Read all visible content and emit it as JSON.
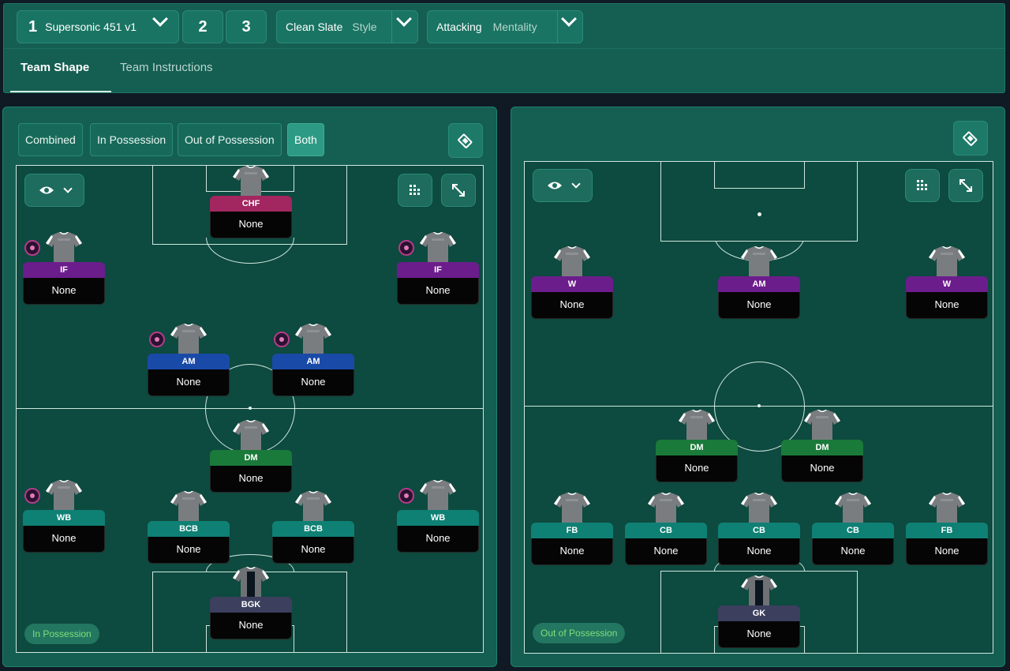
{
  "header": {
    "tactic": {
      "slot": "1",
      "name": "Supersonic 451 v1"
    },
    "slots": [
      "2",
      "3"
    ],
    "style": {
      "value": "Clean Slate",
      "label": "Style"
    },
    "mentality": {
      "value": "Attacking",
      "label": "Mentality"
    },
    "tabs": [
      {
        "label": "Team Shape",
        "active": true
      },
      {
        "label": "Team Instructions",
        "active": false
      }
    ]
  },
  "left_panel": {
    "view_toggle": [
      "Combined",
      "In Possession",
      "Out of Possession",
      "Both"
    ],
    "active_toggle": "Both",
    "phase_label": "In Possession",
    "players": [
      {
        "role": "CHF",
        "name": "None",
        "color": "chf",
        "badge": false
      },
      {
        "role": "IF",
        "name": "None",
        "color": "purple",
        "badge": true
      },
      {
        "role": "IF",
        "name": "None",
        "color": "purple",
        "badge": true
      },
      {
        "role": "AM",
        "name": "None",
        "color": "blue",
        "badge": true
      },
      {
        "role": "AM",
        "name": "None",
        "color": "blue",
        "badge": true
      },
      {
        "role": "DM",
        "name": "None",
        "color": "green",
        "badge": false
      },
      {
        "role": "WB",
        "name": "None",
        "color": "teal",
        "badge": true
      },
      {
        "role": "BCB",
        "name": "None",
        "color": "teal",
        "badge": false
      },
      {
        "role": "BCB",
        "name": "None",
        "color": "teal",
        "badge": false
      },
      {
        "role": "WB",
        "name": "None",
        "color": "teal",
        "badge": true
      },
      {
        "role": "BGK",
        "name": "None",
        "color": "gk",
        "badge": false
      }
    ]
  },
  "right_panel": {
    "phase_label": "Out of Possession",
    "players": [
      {
        "role": "W",
        "name": "None",
        "color": "purple",
        "badge": false
      },
      {
        "role": "AM",
        "name": "None",
        "color": "purple",
        "badge": false
      },
      {
        "role": "W",
        "name": "None",
        "color": "purple",
        "badge": false
      },
      {
        "role": "DM",
        "name": "None",
        "color": "green",
        "badge": false
      },
      {
        "role": "DM",
        "name": "None",
        "color": "green",
        "badge": false
      },
      {
        "role": "FB",
        "name": "None",
        "color": "teal",
        "badge": false
      },
      {
        "role": "CB",
        "name": "None",
        "color": "teal",
        "badge": false
      },
      {
        "role": "CB",
        "name": "None",
        "color": "teal",
        "badge": false
      },
      {
        "role": "CB",
        "name": "None",
        "color": "teal",
        "badge": false
      },
      {
        "role": "FB",
        "name": "None",
        "color": "teal",
        "badge": false
      },
      {
        "role": "GK",
        "name": "None",
        "color": "gk",
        "badge": false
      }
    ]
  },
  "icons": {
    "dropdown": "chevron-down-icon",
    "eye": "eye-icon",
    "grid": "grid-icon",
    "expand": "expand-icon",
    "pitch_toggle": "pitch-toggle-icon",
    "role_badge": "role-badge-icon"
  }
}
